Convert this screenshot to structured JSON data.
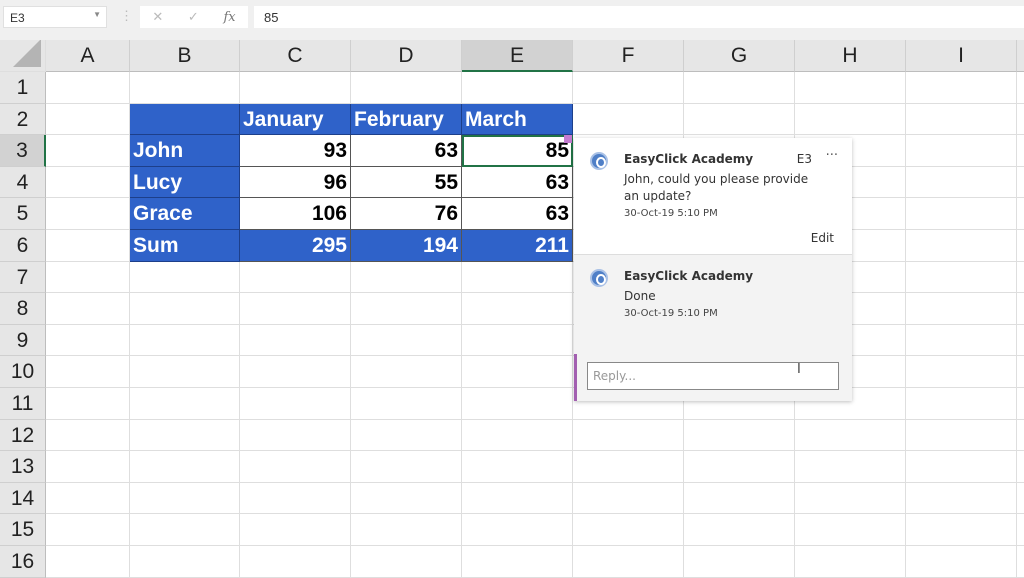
{
  "formula_bar": {
    "name_box": "E3",
    "cancel_icon": "✕",
    "enter_icon": "✓",
    "fx_label": "fx",
    "value": "85"
  },
  "columns": [
    "A",
    "B",
    "C",
    "D",
    "E",
    "F",
    "G",
    "H",
    "I"
  ],
  "rows": [
    "1",
    "2",
    "3",
    "4",
    "5",
    "6",
    "7",
    "8",
    "9",
    "10",
    "11",
    "12",
    "13",
    "14",
    "15",
    "16"
  ],
  "selected_cell": "E3",
  "table": {
    "headers": [
      "",
      "January",
      "February",
      "March"
    ],
    "body": [
      [
        "John",
        "93",
        "63",
        "85"
      ],
      [
        "Lucy",
        "96",
        "55",
        "63"
      ],
      [
        "Grace",
        "106",
        "76",
        "63"
      ]
    ],
    "sum": [
      "Sum",
      "295",
      "194",
      "211"
    ]
  },
  "colors": {
    "table_blue": "#2f62c9",
    "comment_indicator": "#c37bd0"
  },
  "comment": {
    "cell_ref": "E3",
    "more_label": "···",
    "edit_label": "Edit",
    "threads": [
      {
        "author": "EasyClick Academy",
        "text": "John, could you please provide an update?",
        "time": "30-Oct-19 5:10 PM"
      },
      {
        "author": "EasyClick Academy",
        "text": "Done",
        "time": "30-Oct-19 5:10 PM"
      }
    ],
    "reply_placeholder": "Reply..."
  }
}
